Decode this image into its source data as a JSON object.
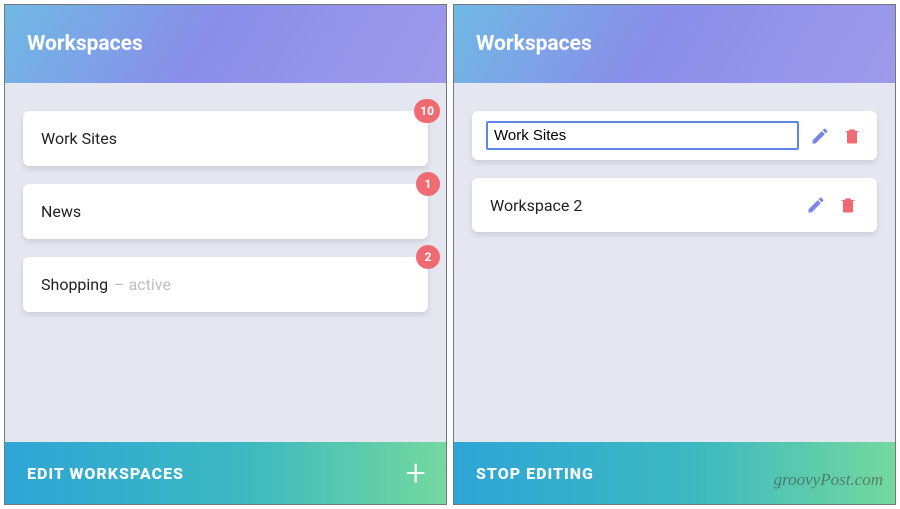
{
  "left": {
    "title": "Workspaces",
    "items": [
      {
        "label": "Work Sites",
        "badge": "10",
        "suffix": ""
      },
      {
        "label": "News",
        "badge": "1",
        "suffix": ""
      },
      {
        "label": "Shopping",
        "badge": "2",
        "suffix": "– active"
      }
    ],
    "footer": "EDIT WORKSPACES"
  },
  "right": {
    "title": "Workspaces",
    "items": [
      {
        "label": "Work Sites",
        "editing": true
      },
      {
        "label": "Workspace 2",
        "editing": false
      }
    ],
    "footer": "STOP EDITING"
  },
  "watermark": "groovyPost.com",
  "colors": {
    "badge": "#f06a72",
    "edit_icon": "#7a88e4",
    "delete_icon": "#f06a72",
    "edit_border": "#5b87e6"
  }
}
